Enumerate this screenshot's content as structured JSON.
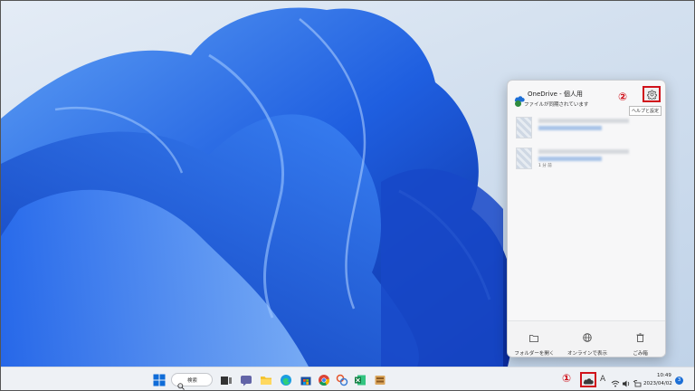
{
  "flyout": {
    "title": "OneDrive - 個人用",
    "status": "ファイルが同期されています",
    "annotation_number": "②",
    "settings_tooltip": "ヘルプと設定",
    "files": [
      {
        "meta": ""
      },
      {
        "meta": "1 分 前"
      }
    ],
    "footer": [
      {
        "label": "フォルダーを開く",
        "icon": "folder-icon"
      },
      {
        "label": "オンラインで表示",
        "icon": "globe-icon"
      },
      {
        "label": "ごみ箱",
        "icon": "recycle-bin-icon"
      }
    ]
  },
  "taskbar": {
    "search_label": "検索",
    "annotation_number": "①",
    "ime_indicator": "A",
    "clock_time": "10:49",
    "clock_date": "2023/04/02",
    "notification_count": "3"
  },
  "colors": {
    "highlight": "#d0121b",
    "accent": "#1d6fd6",
    "sync_ok": "#2e8b3e"
  }
}
